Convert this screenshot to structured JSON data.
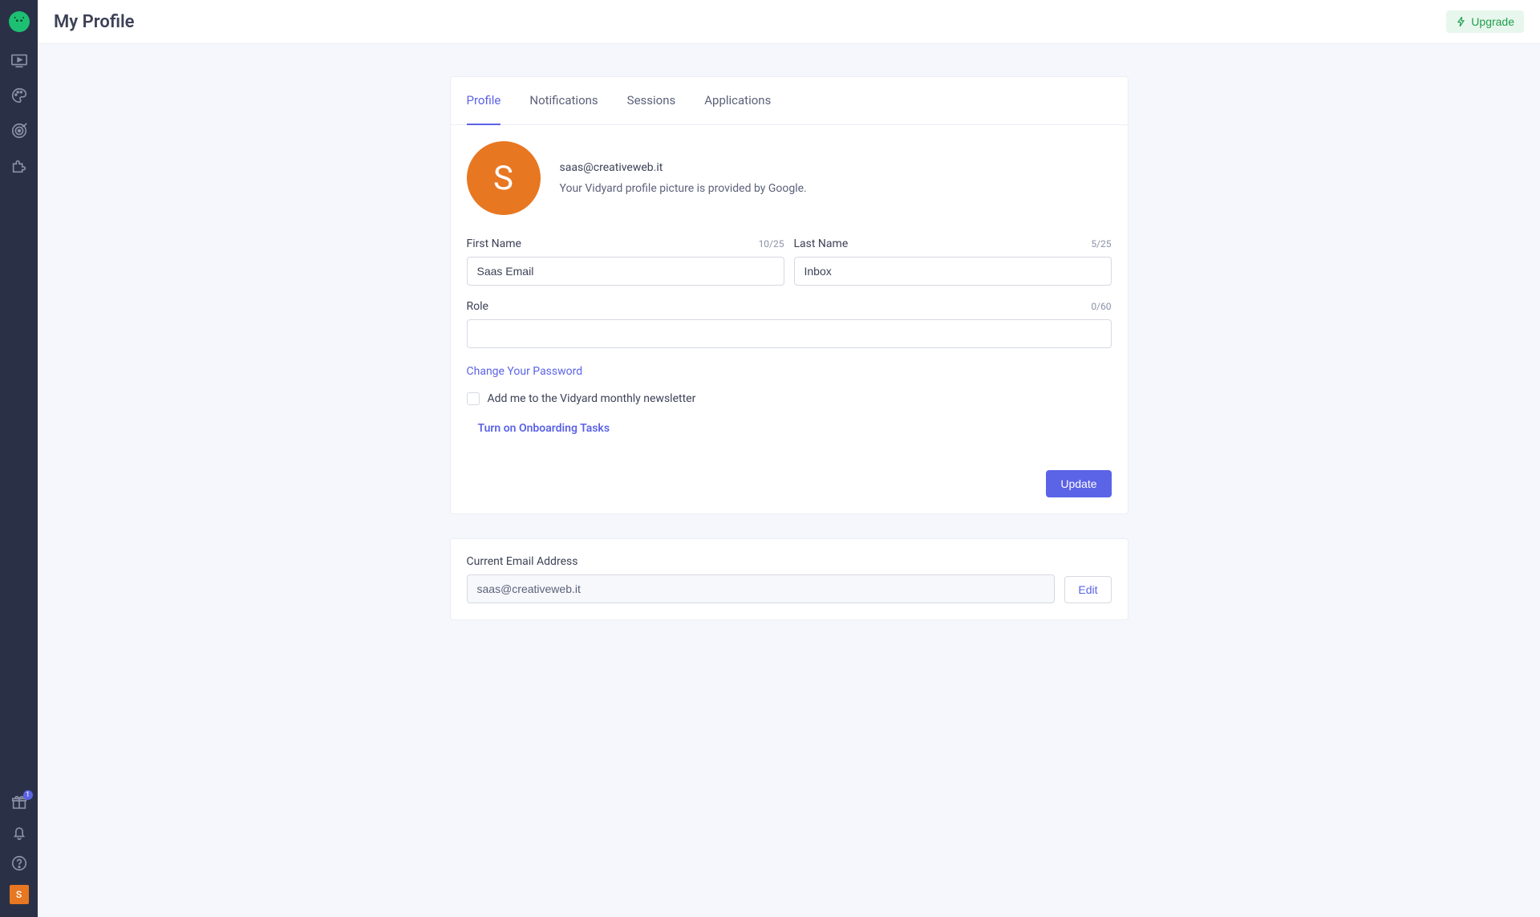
{
  "header": {
    "title": "My Profile",
    "upgrade_label": "Upgrade"
  },
  "sidebar": {
    "gift_badge": "1",
    "avatar_initial": "S"
  },
  "tabs": [
    {
      "label": "Profile",
      "active": true
    },
    {
      "label": "Notifications",
      "active": false
    },
    {
      "label": "Sessions",
      "active": false
    },
    {
      "label": "Applications",
      "active": false
    }
  ],
  "profile": {
    "avatar_initial": "S",
    "email": "saas@creativeweb.it",
    "picture_desc": "Your Vidyard profile picture is provided by Google.",
    "first_name": {
      "label": "First Name",
      "value": "Saas Email",
      "counter": "10/25"
    },
    "last_name": {
      "label": "Last Name",
      "value": "Inbox",
      "counter": "5/25"
    },
    "role": {
      "label": "Role",
      "value": "",
      "counter": "0/60"
    },
    "change_password_label": "Change Your Password",
    "newsletter_label": "Add me to the Vidyard monthly newsletter",
    "onboarding_label": "Turn on Onboarding Tasks",
    "update_label": "Update"
  },
  "email_section": {
    "label": "Current Email Address",
    "value": "saas@creativeweb.it",
    "edit_label": "Edit"
  }
}
